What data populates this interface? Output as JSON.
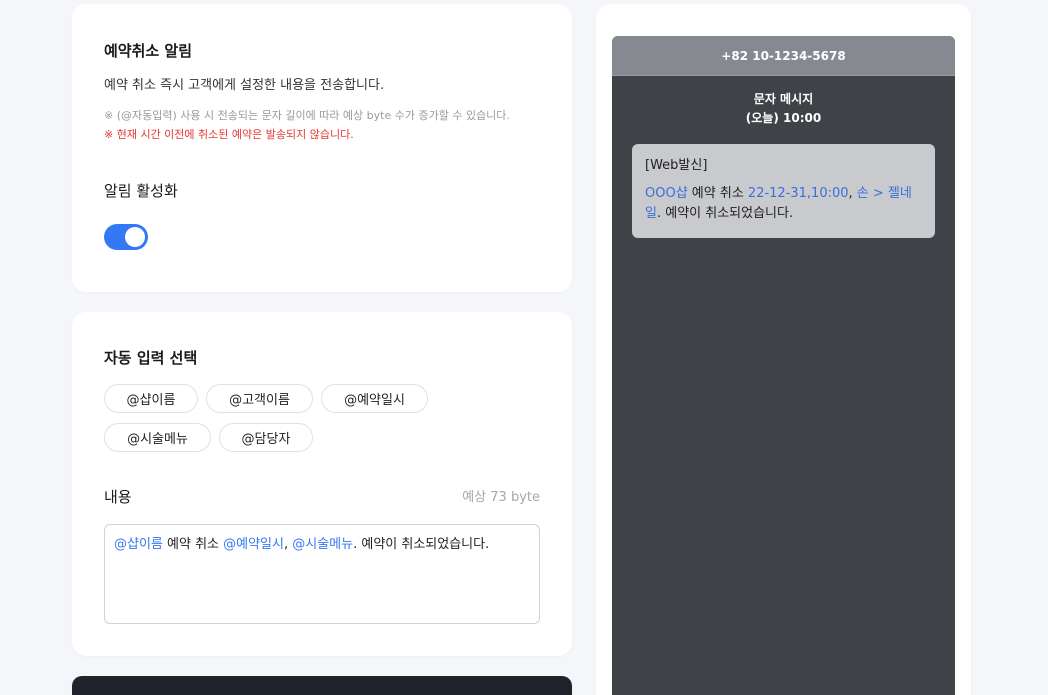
{
  "cancel_alert": {
    "title": "예약취소 알림",
    "description": "예약 취소 즉시 고객에게 설정한 내용을 전송합니다.",
    "note_byte": "※ (@자동입력) 사용 시 전송되는 문자 길이에 따라 예상 byte 수가 증가할 수 있습니다.",
    "note_warning": "※ 현재 시간 이전에 취소된 예약은 발송되지 않습니다.",
    "activation_label": "알림 활성화",
    "toggle_on": true
  },
  "auto_input": {
    "title": "자동 입력 선택",
    "chips": [
      "@샵이름",
      "@고객이름",
      "@예약일시",
      "@시술메뉴",
      "@담당자"
    ],
    "content_label": "내용",
    "byte_estimate": "예상 73 byte",
    "editor": {
      "tok1": "@샵이름",
      "text1": " 예약 취소 ",
      "tok2": "@예약일시",
      "text2": ", ",
      "tok3": "@시술메뉴",
      "text3": ". 예약이 취소되었습니다."
    }
  },
  "preview": {
    "phone_number": "+82 10-1234-5678",
    "message_type": "문자 메시지",
    "message_time": "(오늘) 10:00",
    "bubble": {
      "header": "[Web발신]",
      "shop": "OOO샵",
      "text1": " 예약 취소 ",
      "datetime": "22-12-31,10:00",
      "text2": ", ",
      "menu": "손 > 젤네일",
      "text3": ". 예약이 취소되었습니다."
    }
  },
  "colors": {
    "accent": "#3578f6",
    "warning": "#e53935",
    "phone_bg": "#3f4247"
  }
}
